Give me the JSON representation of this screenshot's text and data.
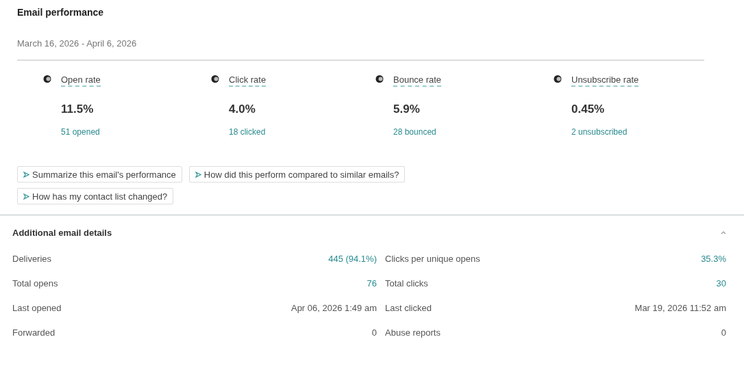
{
  "header": {
    "title": "Email performance",
    "date_range": "March 16, 2026 - April 6, 2026"
  },
  "metrics": [
    {
      "label": "Open rate",
      "value": "11.5%",
      "detail": "51 opened"
    },
    {
      "label": "Click rate",
      "value": "4.0%",
      "detail": "18 clicked"
    },
    {
      "label": "Bounce rate",
      "value": "5.9%",
      "detail": "28 bounced"
    },
    {
      "label": "Unsubscribe rate",
      "value": "0.45%",
      "detail": "2 unsubscribed"
    }
  ],
  "prompts": [
    "Summarize this email's performance",
    "How did this perform compared to similar emails?",
    "How has my contact list changed?"
  ],
  "details": {
    "title": "Additional email details",
    "expanded": true,
    "columns": [
      [
        {
          "label": "Deliveries",
          "value": "445 (94.1%)",
          "kind": "link"
        },
        {
          "label": "Total opens",
          "value": "76",
          "kind": "link"
        },
        {
          "label": "Last opened",
          "value": "Apr 06, 2026 1:49 am",
          "kind": "text"
        },
        {
          "label": "Forwarded",
          "value": "0",
          "kind": "text"
        }
      ],
      [
        {
          "label": "Clicks per unique opens",
          "value": "35.3%",
          "kind": "link"
        },
        {
          "label": "Total clicks",
          "value": "30",
          "kind": "link"
        },
        {
          "label": "Last clicked",
          "value": "Mar 19, 2026 11:52 am",
          "kind": "text"
        },
        {
          "label": "Abuse reports",
          "value": "0",
          "kind": "text"
        }
      ]
    ]
  }
}
